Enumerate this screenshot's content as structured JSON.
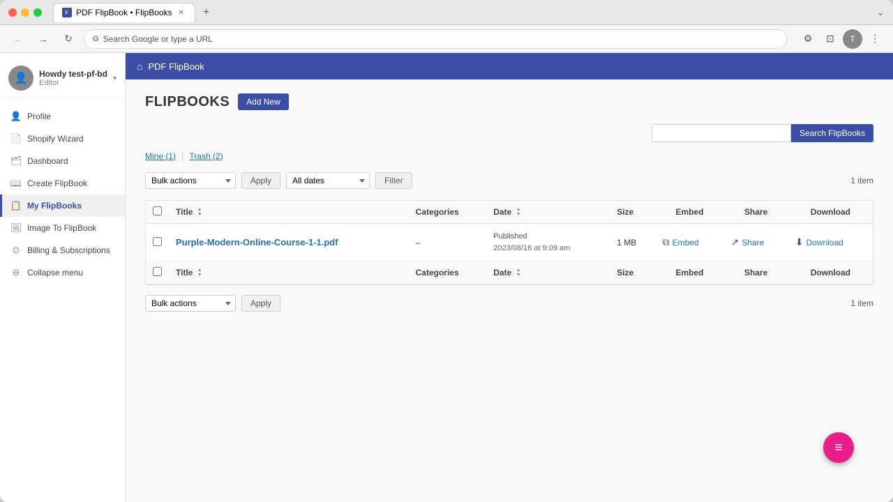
{
  "browser": {
    "tab_title": "PDF FlipBook • FlipBooks",
    "url": "Search Google or type a URL",
    "new_tab_label": "+"
  },
  "header": {
    "home_icon": "⌂",
    "title": "PDF FlipBook"
  },
  "user": {
    "name": "Howdy test-pf-bd",
    "role": "Editor",
    "avatar_icon": "👤"
  },
  "nav": {
    "items": [
      {
        "id": "profile",
        "label": "Profile",
        "icon": "👤"
      },
      {
        "id": "shopify-wizard",
        "label": "Shopify Wizard",
        "icon": "📄"
      },
      {
        "id": "dashboard",
        "label": "Dashboard",
        "icon": "🗂"
      },
      {
        "id": "create-flipbook",
        "label": "Create FlipBook",
        "icon": "📖"
      },
      {
        "id": "my-flipbooks",
        "label": "My FlipBooks",
        "icon": "📋",
        "active": true
      },
      {
        "id": "image-to-flipbook",
        "label": "Image To FlipBook",
        "icon": "🖼"
      },
      {
        "id": "billing-subscriptions",
        "label": "Billing & Subscriptions",
        "icon": "⊙"
      },
      {
        "id": "collapse-menu",
        "label": "Collapse menu",
        "icon": "⊖"
      }
    ]
  },
  "page": {
    "title": "FLIPBOOKS",
    "add_new_label": "Add New"
  },
  "filter_tabs": [
    {
      "id": "mine",
      "label": "Mine (1)"
    },
    {
      "id": "trash",
      "label": "Trash (2)"
    }
  ],
  "search": {
    "placeholder": "",
    "button_label": "Search FlipBooks"
  },
  "top_actions": {
    "bulk_actions_label": "Bulk actions",
    "apply_label": "Apply",
    "all_dates_label": "All dates",
    "filter_label": "Filter",
    "item_count": "1 item"
  },
  "table": {
    "columns": [
      {
        "id": "title",
        "label": "Title"
      },
      {
        "id": "categories",
        "label": "Categories"
      },
      {
        "id": "date",
        "label": "Date"
      },
      {
        "id": "size",
        "label": "Size"
      },
      {
        "id": "embed",
        "label": "Embed"
      },
      {
        "id": "share",
        "label": "Share"
      },
      {
        "id": "download",
        "label": "Download"
      }
    ],
    "rows": [
      {
        "id": "1",
        "title": "Purple-Modern-Online-Course-1-1.pdf",
        "categories": "–",
        "date_status": "Published",
        "date_value": "2023/08/16 at 9:09 am",
        "size": "1 MB",
        "embed_label": "Embed",
        "share_label": "Share",
        "download_label": "Download"
      }
    ]
  },
  "bottom_actions": {
    "bulk_actions_label": "Bulk actions",
    "apply_label": "Apply",
    "item_count": "1 item"
  },
  "fab": {
    "icon": "≡"
  }
}
